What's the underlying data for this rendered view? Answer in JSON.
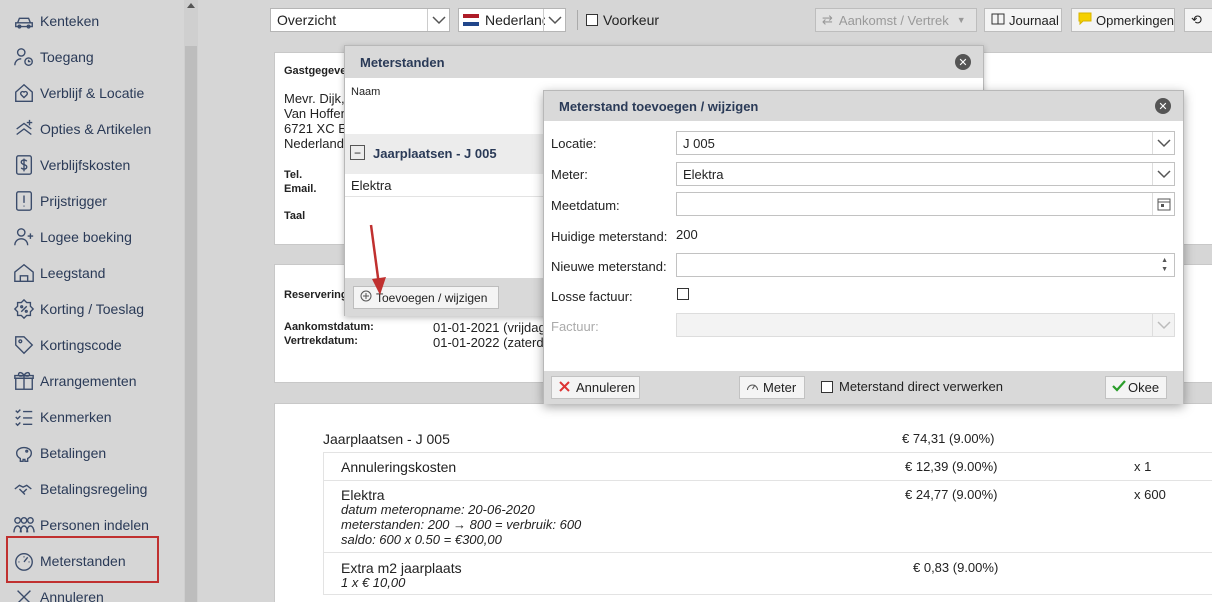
{
  "sidebar": {
    "items": [
      {
        "label": "Kenteken",
        "icon": "car-icon"
      },
      {
        "label": "Toegang",
        "icon": "user-clock-icon"
      },
      {
        "label": "Verblijf & Locatie",
        "icon": "home-heart-icon"
      },
      {
        "label": "Opties & Artikelen",
        "icon": "options-plus-icon"
      },
      {
        "label": "Verblijfskosten",
        "icon": "dollar-icon"
      },
      {
        "label": "Prijstrigger",
        "icon": "exclamation-icon"
      },
      {
        "label": "Logee boeking",
        "icon": "user-plus-icon"
      },
      {
        "label": "Leegstand",
        "icon": "empty-house-icon"
      },
      {
        "label": "Korting / Toeslag",
        "icon": "percent-icon"
      },
      {
        "label": "Kortingscode",
        "icon": "tag-icon"
      },
      {
        "label": "Arrangementen",
        "icon": "gift-icon"
      },
      {
        "label": "Kenmerken",
        "icon": "list-check-icon"
      },
      {
        "label": "Betalingen",
        "icon": "piggy-bank-icon"
      },
      {
        "label": "Betalingsregeling",
        "icon": "handshake-icon"
      },
      {
        "label": "Personen indelen",
        "icon": "people-icon"
      },
      {
        "label": "Meterstanden",
        "icon": "gauge-icon"
      },
      {
        "label": "Annuleren",
        "icon": "close-icon"
      }
    ]
  },
  "topbar": {
    "view_select": "Overzicht",
    "language_select": "Nederland",
    "voorkeur_label": "Voorkeur",
    "aankomst_label": "Aankomst / Vertrek",
    "journaal_label": "Journaal",
    "opmerkingen_label": "Opmerkingen"
  },
  "guest": {
    "section_label": "Gastgegeve",
    "name": "Mevr. Dijk,",
    "street": "Van Hoffen",
    "city": "6721 XC E",
    "country": "Nederland",
    "tel_label": "Tel.",
    "email_label": "Email.",
    "taal_label": "Taal"
  },
  "reservation": {
    "section_label": "Reservering",
    "aankomst_label": "Aankomstdatum:",
    "aankomst_value": "01-01-2021 (vrijdag",
    "vertrek_label": "Vertrekdatum:",
    "vertrek_value": "01-01-2022 (zaterd"
  },
  "costs": {
    "title": "Jaarplaatsen - J 005",
    "title_amount": "€ 74,31 (9.00%)",
    "rows": [
      {
        "name": "Annuleringskosten",
        "amount": "€ 12,39 (9.00%)",
        "qty": "x 1",
        "details": []
      },
      {
        "name": "Elektra",
        "amount": "€ 24,77 (9.00%)",
        "qty": "x 600",
        "details": [
          "datum meteropname: 20-06-2020",
          "meterstanden: 200 → 800 = verbruik: 600",
          "saldo: 600 x 0.50 = €300,00"
        ]
      },
      {
        "name": "Extra m2 jaarplaats",
        "amount": "€ 0,83 (9.00%)",
        "qty": "",
        "details": [
          "1 x € 10,00"
        ]
      }
    ]
  },
  "meterstanden_modal": {
    "title": "Meterstanden",
    "naam_label": "Naam",
    "group_title": "Jaarplaatsen - J 005",
    "row_label": "Elektra",
    "add_button": "Toevoegen / wijzigen"
  },
  "edit_modal": {
    "title": "Meterstand toevoegen / wijzigen",
    "locatie_label": "Locatie:",
    "locatie_value": "J 005",
    "meter_label": "Meter:",
    "meter_value": "Elektra",
    "meetdatum_label": "Meetdatum:",
    "meetdatum_value": "",
    "huidige_label": "Huidige meterstand:",
    "huidige_value": "200",
    "nieuwe_label": "Nieuwe meterstand:",
    "nieuwe_value": "",
    "losse_label": "Losse factuur:",
    "factuur_label": "Factuur:",
    "annuleren_button": "Annuleren",
    "meter_button": "Meter",
    "direct_label": "Meterstand direct verwerken",
    "okee_button": "Okee"
  },
  "colors": {
    "accent_red": "#c0302f",
    "nav_text": "#2a3a57",
    "note_yellow": "#f5d000"
  }
}
